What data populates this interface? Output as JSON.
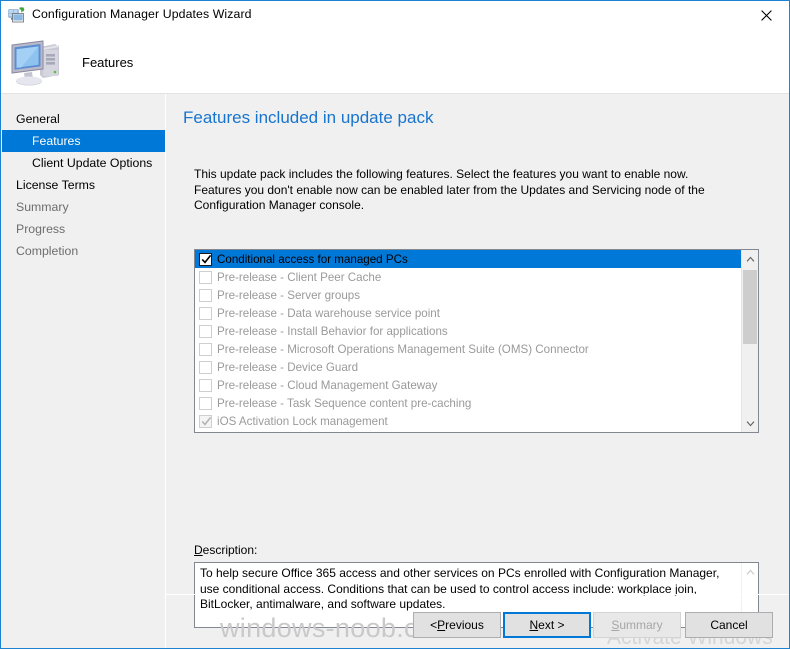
{
  "window": {
    "title": "Configuration Manager Updates Wizard",
    "title_icon": "configmgr-updates-icon",
    "close_label": "✕"
  },
  "header": {
    "title": "Features",
    "icon": "computer-icon"
  },
  "sidebar": {
    "items": [
      {
        "label": "General",
        "level": 0,
        "state": "normal"
      },
      {
        "label": "Features",
        "level": 1,
        "state": "selected"
      },
      {
        "label": "Client Update Options",
        "level": 1,
        "state": "normal"
      },
      {
        "label": "License Terms",
        "level": 0,
        "state": "normal"
      },
      {
        "label": "Summary",
        "level": 0,
        "state": "disabled"
      },
      {
        "label": "Progress",
        "level": 0,
        "state": "disabled"
      },
      {
        "label": "Completion",
        "level": 0,
        "state": "disabled"
      }
    ]
  },
  "main": {
    "heading": "Features included in update pack",
    "intro_line_1": "This update pack includes the following features. Select the features you want to enable now.",
    "intro_line_2": "Features you don't enable now can be enabled later from the Updates and Servicing node of the Configuration Manager console.",
    "features": [
      {
        "label": "Conditional access for managed PCs",
        "checked": true,
        "selected": true,
        "disabled": false
      },
      {
        "label": "Pre-release - Client Peer Cache",
        "checked": false,
        "selected": false,
        "disabled": false
      },
      {
        "label": "Pre-release - Server groups",
        "checked": false,
        "selected": false,
        "disabled": false
      },
      {
        "label": "Pre-release - Data warehouse service point",
        "checked": false,
        "selected": false,
        "disabled": false
      },
      {
        "label": "Pre-release - Install Behavior for applications",
        "checked": false,
        "selected": false,
        "disabled": false
      },
      {
        "label": "Pre-release - Microsoft Operations Management Suite (OMS) Connector",
        "checked": false,
        "selected": false,
        "disabled": false
      },
      {
        "label": "Pre-release - Device Guard",
        "checked": false,
        "selected": false,
        "disabled": false
      },
      {
        "label": "Pre-release - Cloud Management Gateway",
        "checked": false,
        "selected": false,
        "disabled": false
      },
      {
        "label": "Pre-release - Task Sequence content pre-caching",
        "checked": false,
        "selected": false,
        "disabled": false
      },
      {
        "label": "iOS Activation Lock management",
        "checked": true,
        "selected": false,
        "disabled": true
      }
    ],
    "description_label_accel": "D",
    "description_label_rest": "escription:",
    "description_text": "To help secure Office 365 access and other services on PCs enrolled with Configuration Manager, use conditional access. Conditions that can be used to control access include: workplace join, BitLocker, antimalware, and software updates."
  },
  "footer": {
    "buttons": [
      {
        "id": "previous",
        "prefix": "< ",
        "accel": "P",
        "suffix": "revious",
        "state": "normal"
      },
      {
        "id": "next",
        "prefix": "",
        "accel": "N",
        "suffix": "ext >",
        "state": "focused"
      },
      {
        "id": "summary",
        "prefix": "",
        "accel": "S",
        "suffix": "ummary",
        "state": "disabled"
      },
      {
        "id": "cancel",
        "prefix": "",
        "accel": "",
        "suffix": "Cancel",
        "state": "normal"
      }
    ]
  },
  "watermarks": {
    "site": "windows-noob.com",
    "activate": "Activate Windows"
  },
  "colors": {
    "accent": "#0078d7",
    "title_blue": "#1874cd",
    "window_border": "#1e82d2",
    "dialog_bg": "#f0f0f0",
    "disabled_text": "#6d6d6d"
  }
}
